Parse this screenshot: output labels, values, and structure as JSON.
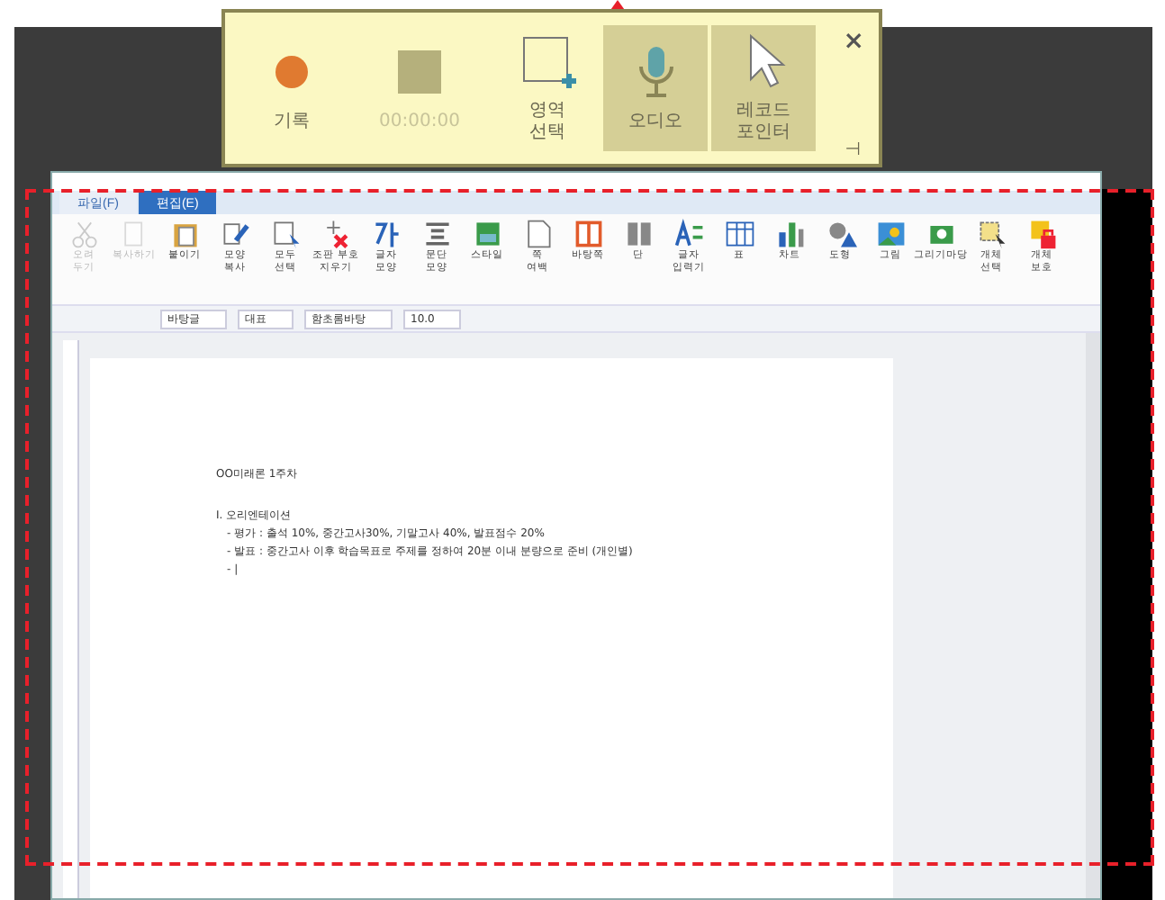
{
  "recorder": {
    "buttons": [
      {
        "kind": "record",
        "label": "기록",
        "selected": false,
        "disabled": false
      },
      {
        "kind": "stop",
        "label": "00:00:00",
        "selected": false,
        "disabled": true
      },
      {
        "kind": "area",
        "label": "영역\n선택",
        "selected": false,
        "disabled": false
      },
      {
        "kind": "audio",
        "label": "오디오",
        "selected": true,
        "disabled": false
      },
      {
        "kind": "pointer",
        "label": "레코드\n포인터",
        "selected": true,
        "disabled": false
      }
    ],
    "close": "×",
    "pin": "⊣"
  },
  "editor": {
    "tabs": [
      {
        "label": "파일(F)",
        "selected": false
      },
      {
        "label": "편집(E)",
        "selected": true
      }
    ],
    "ribbon": [
      {
        "kind": "scissors",
        "label": "오려\n두기",
        "disabled": true
      },
      {
        "kind": "copy",
        "label": "복사하기",
        "disabled": true
      },
      {
        "kind": "paste",
        "label": "붙이기",
        "disabled": false
      },
      {
        "kind": "brush",
        "label": "모양\n복사",
        "disabled": false
      },
      {
        "kind": "select",
        "label": "모두\n선택",
        "disabled": false
      },
      {
        "kind": "erase",
        "label": "조판 부호\n지우기",
        "disabled": false
      },
      {
        "kind": "char",
        "label": "글자\n모양",
        "disabled": false
      },
      {
        "kind": "para",
        "label": "문단\n모양",
        "disabled": false
      },
      {
        "kind": "style",
        "label": "스타일",
        "disabled": false
      },
      {
        "kind": "page",
        "label": "쪽\n여백",
        "disabled": false
      },
      {
        "kind": "master",
        "label": "바탕쪽",
        "disabled": false
      },
      {
        "kind": "columns",
        "label": "단",
        "disabled": false
      },
      {
        "kind": "input",
        "label": "글자\n입력기",
        "disabled": false
      },
      {
        "kind": "table",
        "label": "표",
        "disabled": false
      },
      {
        "kind": "chart",
        "label": "차트",
        "disabled": false
      },
      {
        "kind": "shape",
        "label": "도형",
        "disabled": false
      },
      {
        "kind": "picture",
        "label": "그림",
        "disabled": false
      },
      {
        "kind": "gallery",
        "label": "그리기마당",
        "disabled": false
      },
      {
        "kind": "objsel",
        "label": "개체\n선택",
        "disabled": false
      },
      {
        "kind": "lock",
        "label": "개체\n보호",
        "disabled": false
      }
    ],
    "format": {
      "style": "바탕글",
      "lang": "대표",
      "font": "함초롬바탕",
      "size": "10.0"
    },
    "document": {
      "heading": "OO미래론 1주차",
      "lines": [
        "I. 오리엔테이션",
        "- 평가 : 출석 10%, 중간고사30%, 기말고사 40%, 발표점수 20%",
        "- 발표 : 중간고사 이후 학습목표로 주제를 정하여 20분 이내 분량으로 준비 (개인별)",
        "- |"
      ]
    }
  }
}
